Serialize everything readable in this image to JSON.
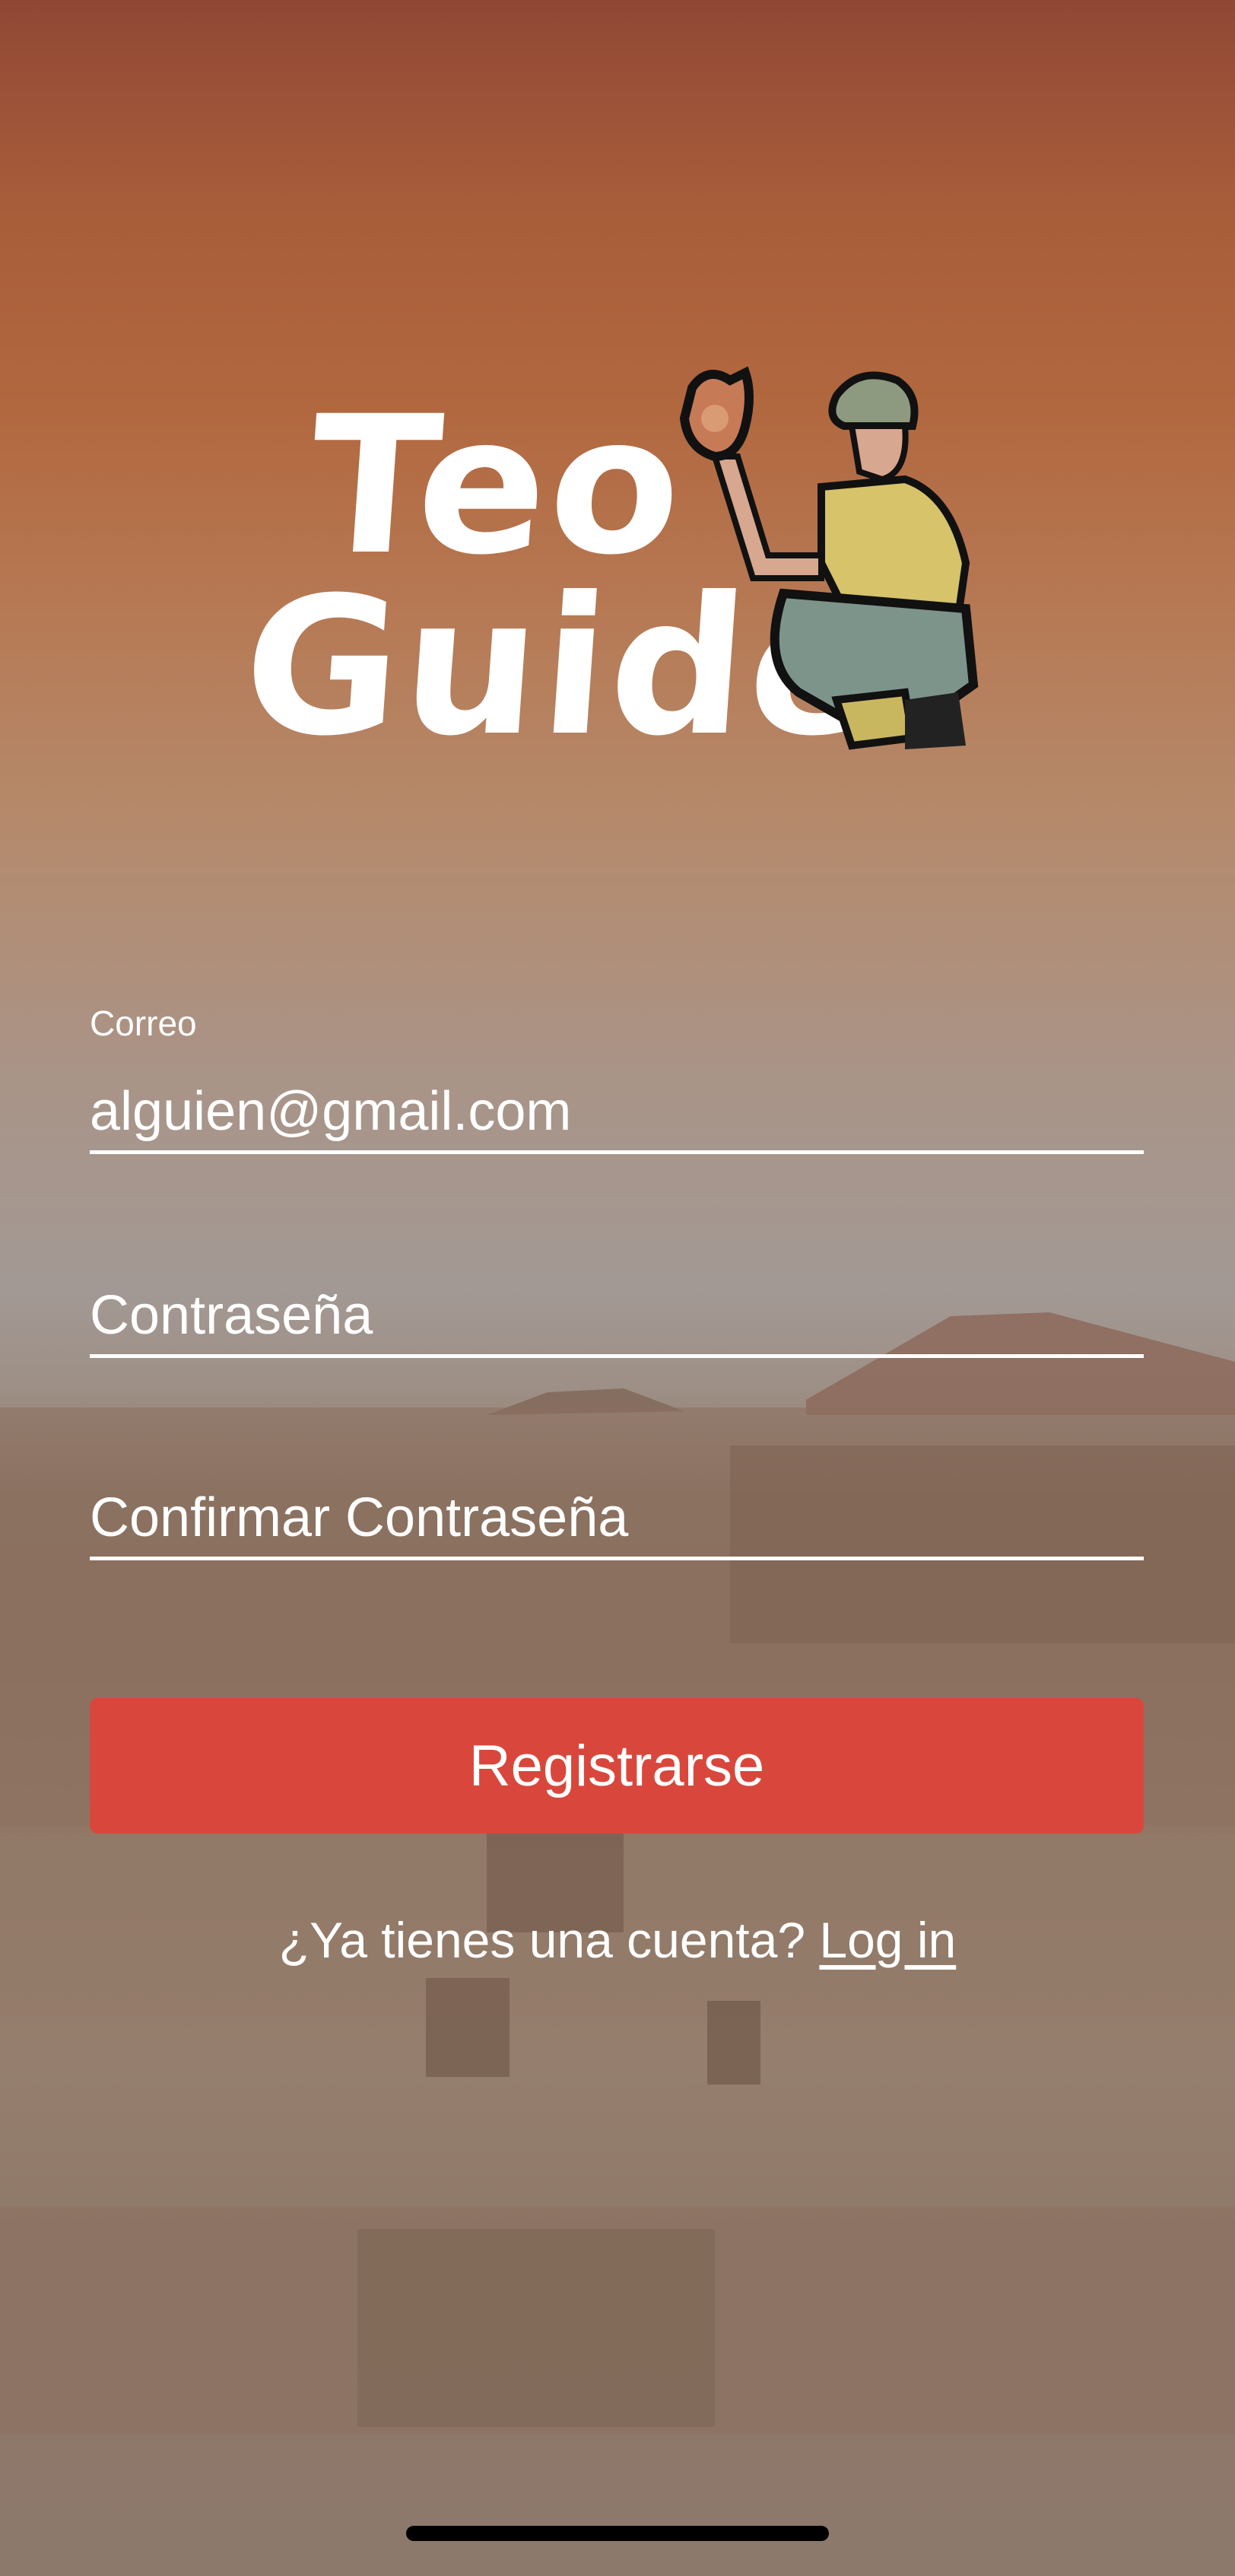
{
  "logo": {
    "line1": "Teo",
    "line2": "Guide",
    "mascot_icon": "explorer-holding-artifact-icon"
  },
  "form": {
    "email_label": "Correo",
    "email_value": "alguien@gmail.com",
    "password_placeholder": "Contraseña",
    "confirm_placeholder": "Confirmar Contraseña",
    "register_label": "Registrarse"
  },
  "footer": {
    "prompt": "¿Ya tienes una cuenta? ",
    "login_label": "Log in"
  },
  "colors": {
    "accent": "#d9473c",
    "text": "#ffffff"
  }
}
